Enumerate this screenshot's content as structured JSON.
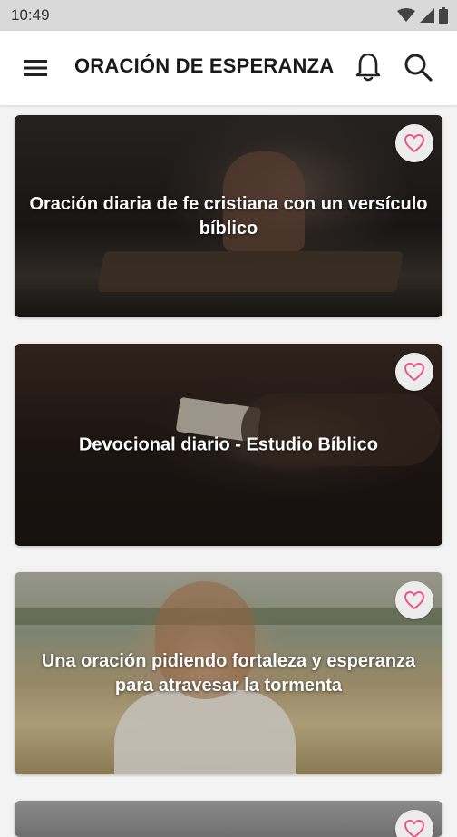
{
  "status_bar": {
    "time": "10:49"
  },
  "app_bar": {
    "title": "ORACIÓN DE ESPERANZA"
  },
  "cards": [
    {
      "title": "Oración diaria de fe cristiana con un versículo bíblico"
    },
    {
      "title": "Devocional diario - Estudio Bíblico"
    },
    {
      "title": "Una oración pidiendo fortaleza y esperanza para atravesar la tormenta"
    },
    {
      "title": ""
    }
  ],
  "colors": {
    "favorite_accent": "#e8578a",
    "app_bar_bg": "#ffffff",
    "status_bar_bg": "#d9d9d9"
  },
  "icons": {
    "menu": "menu-icon",
    "notifications": "bell-icon",
    "search": "search-icon",
    "favorite": "heart-outline-icon"
  }
}
